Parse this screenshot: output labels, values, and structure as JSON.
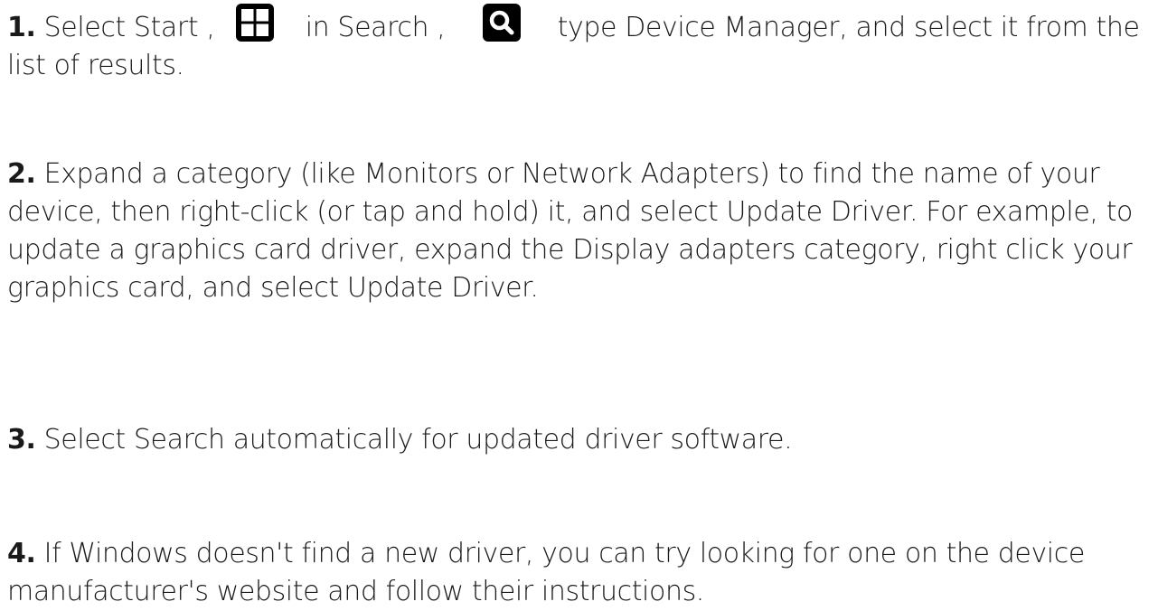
{
  "steps": [
    {
      "number": "1.",
      "pre": "Select Start ,",
      "icon1": "windows-logo-icon",
      "mid": "in Search ,",
      "icon2": "search-icon",
      "post": "type Device Manager, and select it from the list of results."
    },
    {
      "number": "2.",
      "text": "Expand a category (like Monitors or Network Adapters) to find the name of your device, then right-click (or tap and hold) it, and select Update Driver. For example, to update a graphics card driver, expand the Display adapters category, right click your graphics card, and select Update Driver."
    },
    {
      "number": "3.",
      "text": "Select Search automatically for updated driver software."
    },
    {
      "number": "4.",
      "text": "If Windows doesn't find a new driver, you can try looking for one on the device manufacturer's website and follow their instructions."
    }
  ],
  "colors": {
    "text": "#1a1a1a",
    "icon_bg": "#000000",
    "icon_fg": "#ffffff"
  }
}
